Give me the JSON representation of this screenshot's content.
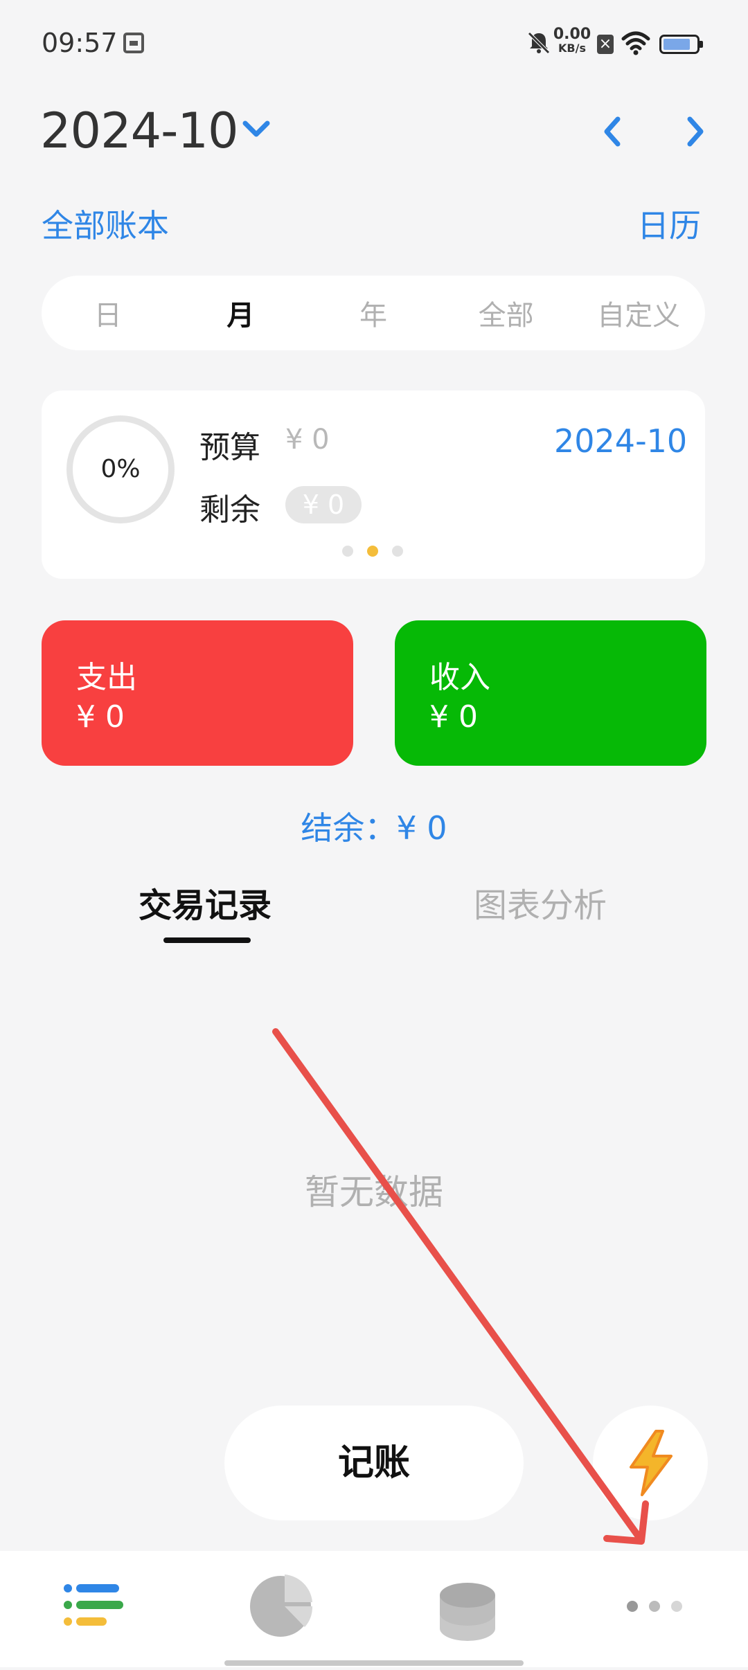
{
  "status_bar": {
    "time": "09:57",
    "net_speed": "0.00",
    "net_speed_unit": "KB/s",
    "icons": [
      "calendar-card-icon",
      "bell-mute-icon",
      "close-box-icon",
      "wifi-icon",
      "battery-icon"
    ]
  },
  "header": {
    "month": "2024-10",
    "all_books": "全部账本",
    "calendar": "日历"
  },
  "period_tabs": [
    "日",
    "月",
    "年",
    "全部",
    "自定义"
  ],
  "period_tabs_active": "月",
  "budget": {
    "percent": "0%",
    "budget_label": "预算",
    "budget_value": "¥ 0",
    "remaining_label": "剩余",
    "remaining_value": "¥ 0",
    "period": "2024-10",
    "pager_active_index": 1
  },
  "expense": {
    "label": "支出",
    "value": "¥ 0"
  },
  "income": {
    "label": "收入",
    "value": "¥ 0"
  },
  "balance": {
    "label": "结余：",
    "value": "¥ 0"
  },
  "content_tabs": {
    "transactions": "交易记录",
    "charts": "图表分析"
  },
  "empty_state": "暂无数据",
  "actions": {
    "record": "记账"
  },
  "bottom_nav": [
    "list-icon",
    "pie-chart-icon",
    "coin-stack-icon",
    "more-dots-icon"
  ],
  "colors": {
    "accent_blue": "#2f86e6",
    "expense_red": "#f84040",
    "income_green": "#06b906",
    "pager_active": "#f4bd3a",
    "annotation_arrow": "#e8504a"
  }
}
